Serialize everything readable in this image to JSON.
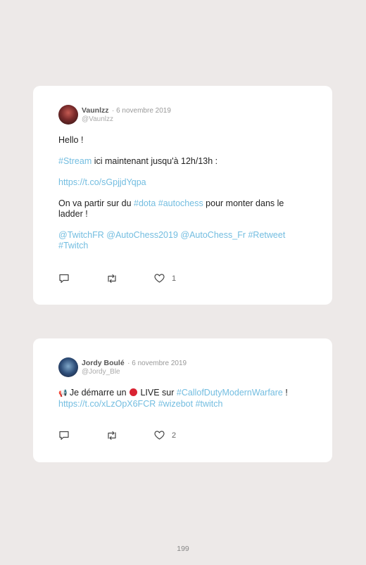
{
  "tweets": [
    {
      "name": "Vaunlzz",
      "date": "· 6 novembre 2019",
      "handle": "@Vaunlzz",
      "line_hello": "Hello !",
      "line2_tag": "#Stream",
      "line2_text": " ici maintenant jusqu'à 12h/13h :",
      "line3_link": "https://t.co/sGpjjdYqpa",
      "line4_a": "On va partir sur du ",
      "line4_tag1": "#dota",
      "line4_sp": " ",
      "line4_tag2": "#autochess",
      "line4_b": " pour monter dans le ladder !",
      "mentions": [
        "@TwitchFR",
        "@AutoChess2019",
        "@AutoChess_Fr",
        "#Retweet",
        "#Twitch"
      ],
      "likes": "1"
    },
    {
      "name": "Jordy Boulé",
      "date": "· 6 novembre 2019",
      "handle": "@Jordy_Ble",
      "megaphone": "📢",
      "text_a": " Je démarre un ",
      "text_b": " LIVE sur ",
      "tag": "#CallofDutyModernWarfare",
      "text_c": " !",
      "link": "https://t.co/xLzOpX6FCR",
      "tag2": "#wizebot",
      "tag3": "#twitch",
      "likes": "2"
    }
  ],
  "page_number": "199",
  "icons": {
    "reply": "reply-icon",
    "retweet": "retweet-icon",
    "like": "heart-icon",
    "live": "red-circle-icon",
    "megaphone": "megaphone-icon"
  },
  "colors": {
    "link": "#73bde0",
    "background": "#ede9e8",
    "card": "#ffffff"
  }
}
